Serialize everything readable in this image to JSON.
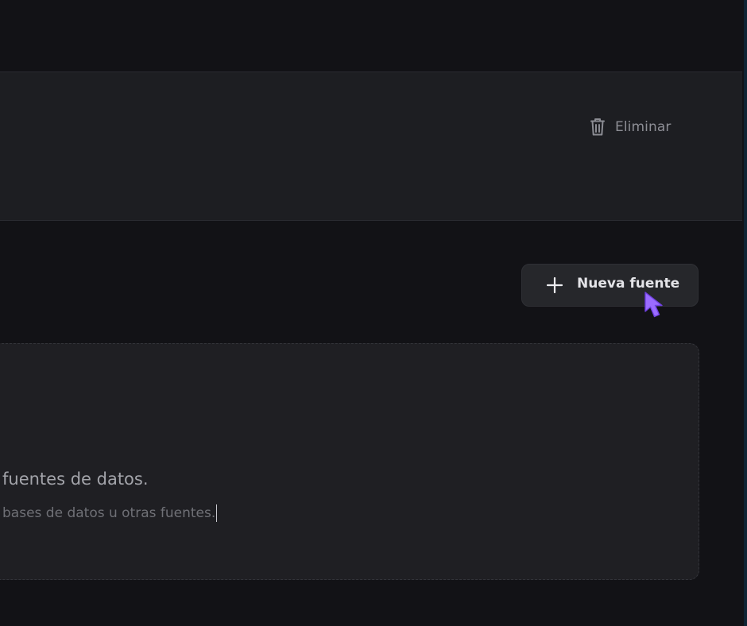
{
  "header_panel": {
    "delete_label": "Eliminar",
    "delete_icon": "trash-icon"
  },
  "toolbar": {
    "new_source_label": "Nueva fuente",
    "new_source_icon": "plus-icon"
  },
  "empty_state": {
    "title": "fuentes de datos.",
    "description": "bases de datos u otras fuentes."
  },
  "colors": {
    "background": "#121216",
    "panel": "#1d1e22",
    "button": "#26272b",
    "cursor_accent": "#9b6cff",
    "edge_accent": "#0f2434"
  },
  "cursor": {
    "icon": "mouse-pointer-icon"
  }
}
